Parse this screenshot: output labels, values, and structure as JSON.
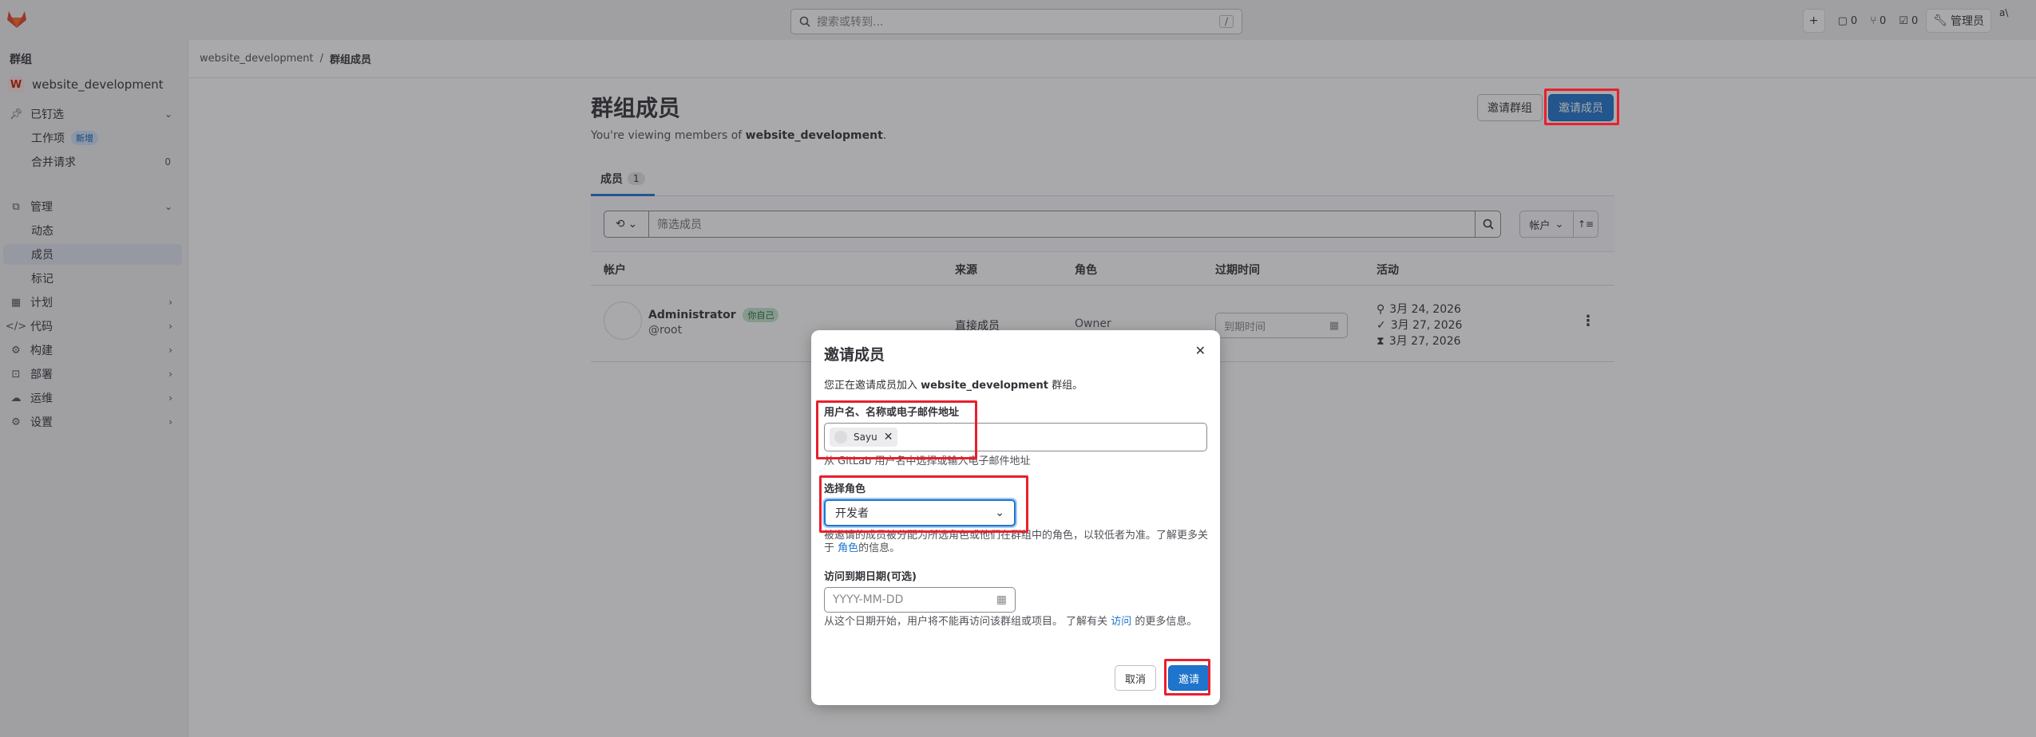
{
  "topbar": {
    "search_placeholder": "搜索或转到...",
    "search_shortcut": "/",
    "plus_label": "+",
    "issues_count": "0",
    "mr_count": "0",
    "todo_count": "0",
    "admin_label": "管理员",
    "avatar_alt": "a\\"
  },
  "sidebar": {
    "title": "群组",
    "group_initial": "W",
    "group_name": "website_development",
    "pinned": "已钉选",
    "pinned_items": [
      {
        "label": "工作项",
        "badge": "新增"
      },
      {
        "label": "合并请求",
        "count": "0"
      }
    ],
    "manage": "管理",
    "manage_items": [
      "动态",
      "成员",
      "标记"
    ],
    "sections": [
      "计划",
      "代码",
      "构建",
      "部署",
      "运维",
      "设置"
    ]
  },
  "breadcrumb": {
    "group": "website_development",
    "separator": "/",
    "current": "群组成员"
  },
  "main": {
    "title": "群组成员",
    "subtitle_prefix": "You're viewing members of ",
    "subtitle_group": "website_development",
    "subtitle_suffix": ".",
    "invite_group_label": "邀请群组",
    "invite_member_label": "邀请成员",
    "tab_label": "成员",
    "tab_count": "1",
    "filter_placeholder": "筛选成员",
    "sort_label": "帐户",
    "columns": [
      "帐户",
      "来源",
      "角色",
      "过期时间",
      "活动"
    ],
    "member": {
      "name": "Administrator",
      "you_badge": "你自己",
      "handle": "@root",
      "source": "直接成员",
      "role": "Owner",
      "expiry_placeholder": "到期时间",
      "activity": [
        "3月 24, 2026",
        "3月 27, 2026",
        "3月 27, 2026"
      ]
    }
  },
  "modal": {
    "title": "邀请成员",
    "intro_prefix": "您正在邀请成员加入 ",
    "intro_group": "website_development",
    "intro_suffix": " 群组。",
    "username_label": "用户名、名称或电子邮件地址",
    "token_name": "Sayu",
    "username_help": "从 GitLab 用户名中选择或输入电子邮件地址",
    "role_label": "选择角色",
    "role_value": "开发者",
    "role_help_prefix": "被邀请的成员被分配为所选角色或他们在群组中的角色，以较低者为准。了解更多关于 ",
    "role_help_link": "角色",
    "role_help_suffix": "的信息。",
    "date_label": "访问到期日期(可选)",
    "date_placeholder": "YYYY-MM-DD",
    "date_help_prefix": "从这个日期开始，用户将不能再访问该群组或项目。 了解有关 ",
    "date_help_link": "访问",
    "date_help_suffix": " 的更多信息。",
    "cancel_label": "取消",
    "invite_label": "邀请"
  },
  "colors": {
    "accent": "#1f75cb",
    "highlight_box": "#e8202e"
  }
}
